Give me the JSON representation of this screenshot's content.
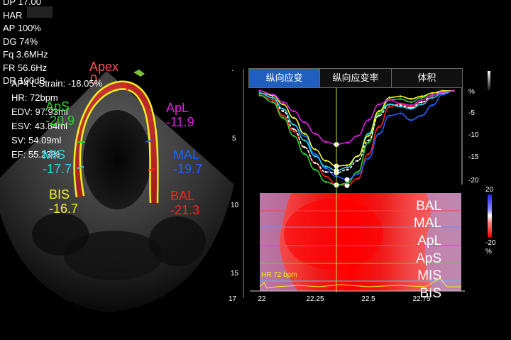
{
  "params": [
    "DP 17.00",
    "HAR",
    "AP 100%",
    "DG 74%",
    "Fq 3.6MHz",
    "FR 56.6Hz",
    "DR 100dB"
  ],
  "strain_info": [
    "AP4 L Strain: -18.05%",
    "HR:  72bpm",
    "EDV: 97.93ml",
    "ESV: 43.84ml",
    "SV: 54.09ml",
    "EF: 55.23%"
  ],
  "apex": {
    "name": "Apex",
    "value": "0"
  },
  "segments": [
    {
      "name": "ApS",
      "value": "-20.9",
      "color": "#2bd62b"
    },
    {
      "name": "ApL",
      "value": "-11.9",
      "color": "#e020e0"
    },
    {
      "name": "MIS",
      "value": "-17.7",
      "color": "#2ad7ea"
    },
    {
      "name": "MAL",
      "value": "-19.7",
      "color": "#2060ff"
    },
    {
      "name": "BIS",
      "value": "-16.7",
      "color": "#f2f21c"
    },
    {
      "name": "BAL",
      "value": "-21.3",
      "color": "#ff2020"
    }
  ],
  "tabs": [
    {
      "label": "纵向应变",
      "active": true
    },
    {
      "label": "纵向应变率",
      "active": false
    },
    {
      "label": "体积",
      "active": false
    }
  ],
  "strain_axis": {
    "unit": "%",
    "ticks": [
      0,
      -5,
      -10,
      -15,
      -20
    ]
  },
  "time_axis": {
    "ticks": [
      "22",
      "22.25",
      "22.5",
      "22.75"
    ]
  },
  "left_ticks": [
    "5",
    "10",
    "15",
    "17"
  ],
  "color_scale": {
    "max": "20",
    "min": "-20",
    "unit": "%"
  },
  "heatmap_labels": [
    "BAL",
    "MAL",
    "ApL",
    "ApS",
    "MIS",
    "BIS"
  ],
  "hr_label": "HR 72 bpm",
  "colors": {
    "accent_tab": "#1f5fbf",
    "marker": "#c8e040",
    "contour": "#f2f21c"
  },
  "chart_data": {
    "type": "line",
    "x": [
      21.99,
      22.05,
      22.1,
      22.15,
      22.2,
      22.25,
      22.3,
      22.35,
      22.4,
      22.45,
      22.5,
      22.55,
      22.6,
      22.65,
      22.7,
      22.75,
      22.8,
      22.85,
      22.9
    ],
    "ylim": [
      -21,
      1
    ],
    "series": [
      {
        "color": "#ff2020",
        "values": [
          -1,
          -2,
          -5.5,
          -9,
          -12.5,
          -16,
          -19,
          -20.8,
          -21,
          -19.5,
          -14,
          -8,
          -3.5,
          -3,
          -3.5,
          -2.5,
          -1.5,
          -0.5,
          0
        ]
      },
      {
        "color": "#2bd62b",
        "values": [
          -1,
          -2.5,
          -6,
          -10,
          -14,
          -17.5,
          -20.2,
          -20.9,
          -20.5,
          -18,
          -11.5,
          -5,
          -2,
          -1.8,
          -2.5,
          -1.5,
          -0.5,
          0,
          0
        ]
      },
      {
        "color": "#2060ff",
        "values": [
          -0.5,
          -1,
          -3,
          -6,
          -10,
          -14,
          -17.2,
          -19,
          -19.7,
          -18.5,
          -15,
          -9.5,
          -5.5,
          -5,
          -6.5,
          -5.5,
          -3.2,
          -0.8,
          0
        ]
      },
      {
        "color": "#ffffff",
        "values": [
          -0.5,
          -1.5,
          -4.5,
          -8.5,
          -12.5,
          -16,
          -18,
          -18.2,
          -17.5,
          -15.5,
          -11,
          -5.5,
          -3,
          -3.2,
          -3.8,
          -2.5,
          -1,
          0,
          0
        ]
      },
      {
        "color": "#2ad7ea",
        "values": [
          -0.5,
          -1.5,
          -4,
          -7.5,
          -11,
          -14.5,
          -16.8,
          -17.7,
          -17,
          -14.5,
          -9.5,
          -4.5,
          -3,
          -3.5,
          -4,
          -3,
          -1.5,
          -0.5,
          0
        ]
      },
      {
        "color": "#f2f21c",
        "values": [
          0,
          -1,
          -3,
          -6,
          -9.5,
          -13,
          -15.5,
          -16.7,
          -16.5,
          -14.5,
          -10,
          -4.5,
          -1.5,
          -1.2,
          -1.8,
          -1.2,
          -0.5,
          0,
          0
        ]
      },
      {
        "color": "#e020e0",
        "values": [
          0,
          -0.8,
          -2.5,
          -4.5,
          -7,
          -9.5,
          -11.3,
          -11.9,
          -11.5,
          -10,
          -6.5,
          -3,
          -2,
          -2.8,
          -3.2,
          -2,
          -1,
          -0.3,
          0
        ]
      }
    ]
  }
}
